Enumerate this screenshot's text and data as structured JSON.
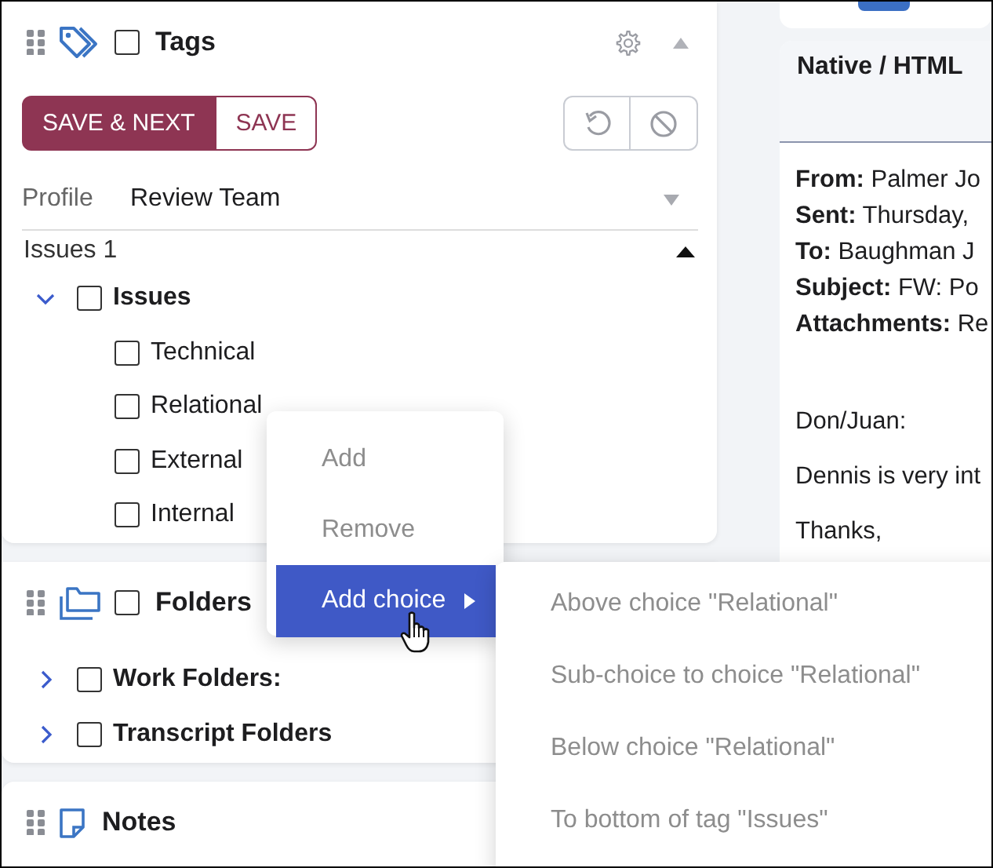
{
  "tags_panel": {
    "title": "Tags",
    "checked": false,
    "buttons": [
      {
        "label": "SAVE & NEXT",
        "kind": "primary"
      },
      {
        "label": "SAVE",
        "kind": "secondary"
      }
    ],
    "profile": {
      "label": "Profile",
      "value": "Review Team"
    },
    "group": {
      "label": "Issues 1",
      "expanded": true
    },
    "tree": [
      {
        "label": "Issues",
        "checked": false,
        "expanded": true,
        "children": [
          {
            "label": "Technical",
            "checked": false
          },
          {
            "label": "Relational",
            "checked": false
          },
          {
            "label": "External",
            "checked": false
          },
          {
            "label": "Internal",
            "checked": false
          }
        ]
      }
    ]
  },
  "context_menu": {
    "items": [
      {
        "label": "Add",
        "selected": false,
        "submenu": false
      },
      {
        "label": "Remove",
        "selected": false,
        "submenu": false
      },
      {
        "label": "Add choice",
        "selected": true,
        "submenu": true
      }
    ]
  },
  "submenu": {
    "items": [
      {
        "label": "Above choice \"Relational\""
      },
      {
        "label": "Sub-choice to choice \"Relational\""
      },
      {
        "label": "Below choice \"Relational\""
      },
      {
        "label": "To bottom of tag \"Issues\""
      }
    ]
  },
  "folders_panel": {
    "title": "Folders",
    "checked": false,
    "tree": [
      {
        "label": "Work Folders:",
        "checked": false,
        "expanded": false
      },
      {
        "label": "Transcript Folders",
        "checked": false,
        "expanded": false
      }
    ]
  },
  "notes_panel": {
    "title": "Notes"
  },
  "document": {
    "title": "Native / HTML",
    "headers": [
      "**From:** Palmer Jo",
      "**Sent:** Thursday,",
      "**To:** Baughman J",
      "**Subject:** FW: Po",
      "**Attachments:** Re"
    ],
    "body": [
      "Don/Juan:",
      "Dennis is very int",
      "Thanks,"
    ]
  }
}
